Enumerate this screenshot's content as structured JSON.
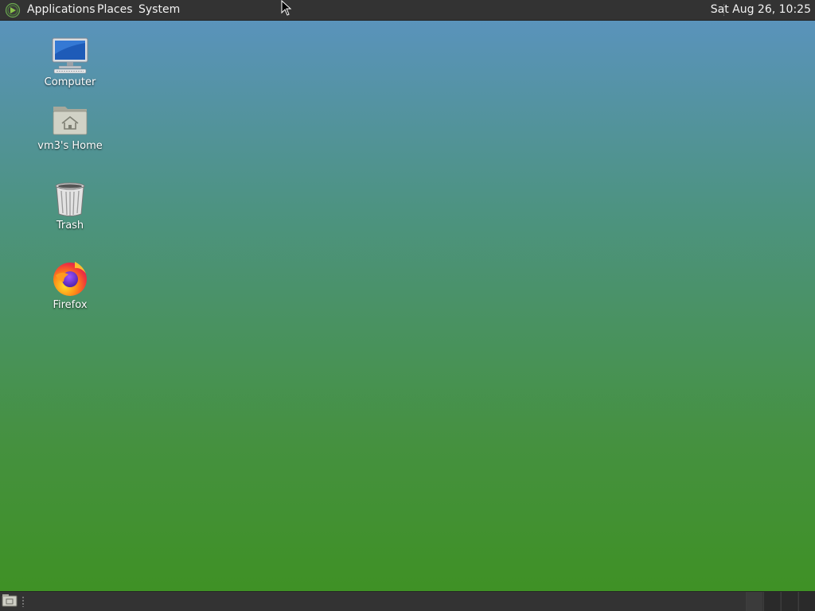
{
  "top_panel": {
    "menus": [
      {
        "label": "Applications"
      },
      {
        "label": "Places"
      },
      {
        "label": "System"
      }
    ],
    "clock": "Sat Aug 26, 10:25"
  },
  "desktop": {
    "icons": [
      {
        "label": "Computer",
        "icon": "computer-icon"
      },
      {
        "label": "vm3's Home",
        "icon": "home-folder-icon"
      },
      {
        "label": "Trash",
        "icon": "trash-icon"
      },
      {
        "label": "Firefox",
        "icon": "firefox-icon"
      }
    ]
  },
  "bottom_panel": {
    "workspaces": 4
  },
  "colors": {
    "panel": "#333333",
    "desktop_top": "#5b93c2",
    "desktop_bottom": "#3f9125"
  }
}
